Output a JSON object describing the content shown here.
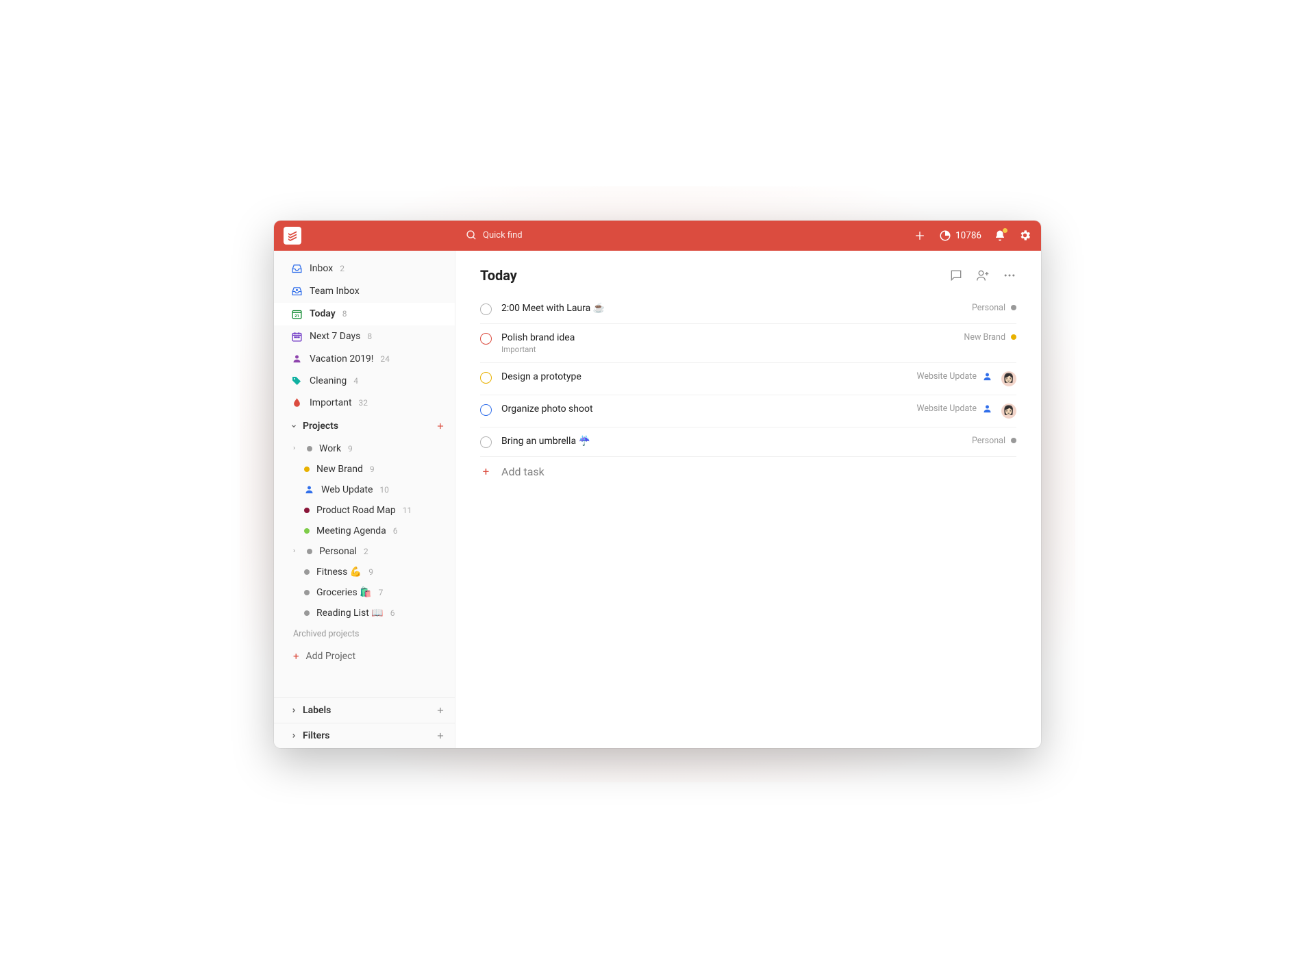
{
  "header": {
    "search_placeholder": "Quick find",
    "karma_points": "10786"
  },
  "sidebar": {
    "nav": [
      {
        "label": "Inbox",
        "count": "2",
        "icon": "inbox",
        "color": "#316fea"
      },
      {
        "label": "Team Inbox",
        "count": "",
        "icon": "team-inbox",
        "color": "#316fea"
      },
      {
        "label": "Today",
        "count": "8",
        "icon": "today",
        "color": "#058527",
        "active": true
      },
      {
        "label": "Next 7 Days",
        "count": "8",
        "icon": "calendar",
        "color": "#692fc2"
      },
      {
        "label": "Vacation 2019!",
        "count": "24",
        "icon": "person",
        "color": "#8e44ad"
      },
      {
        "label": "Cleaning",
        "count": "4",
        "icon": "tag",
        "color": "#0fb0a1"
      },
      {
        "label": "Important",
        "count": "32",
        "icon": "drop",
        "color": "#db4c3f"
      }
    ],
    "projects_label": "Projects",
    "projects": [
      {
        "label": "Work",
        "count": "9",
        "expandable": true,
        "color": "#999999"
      },
      {
        "label": "New Brand",
        "count": "9",
        "sub": true,
        "color": "#e8b100"
      },
      {
        "label": "Web Update",
        "count": "10",
        "sub": true,
        "color": "#316fea",
        "icon": "person"
      },
      {
        "label": "Product Road Map",
        "count": "11",
        "sub": true,
        "color": "#8a1538"
      },
      {
        "label": "Meeting Agenda",
        "count": "6",
        "sub": true,
        "color": "#7ecc49"
      },
      {
        "label": "Personal",
        "count": "2",
        "expandable": true,
        "color": "#999999"
      },
      {
        "label": "Fitness 💪",
        "count": "9",
        "sub": true,
        "color": "#999999"
      },
      {
        "label": "Groceries 🛍️",
        "count": "7",
        "sub": true,
        "color": "#999999"
      },
      {
        "label": "Reading List 📖",
        "count": "6",
        "sub": true,
        "color": "#999999"
      }
    ],
    "archived_label": "Archived projects",
    "add_project_label": "Add Project",
    "labels_label": "Labels",
    "filters_label": "Filters"
  },
  "main": {
    "title": "Today",
    "add_task_label": "Add task",
    "tasks": [
      {
        "title": "2:00 Meet with Laura ☕",
        "sub": "",
        "project": "Personal",
        "project_color": "#999999",
        "circle_color": "#b3b3b3"
      },
      {
        "title": "Polish brand idea",
        "sub": "Important",
        "project": "New Brand",
        "project_color": "#e8b100",
        "circle_color": "#db4c3f"
      },
      {
        "title": "Design a prototype",
        "sub": "",
        "project": "Website Update",
        "project_color": "",
        "circle_color": "#e8b100",
        "assignee": true,
        "avatar": true
      },
      {
        "title": "Organize photo shoot",
        "sub": "",
        "project": "Website Update",
        "project_color": "",
        "circle_color": "#316fea",
        "assignee": true,
        "avatar": true
      },
      {
        "title": "Bring an umbrella ☔",
        "sub": "",
        "project": "Personal",
        "project_color": "#999999",
        "circle_color": "#b3b3b3"
      }
    ]
  }
}
